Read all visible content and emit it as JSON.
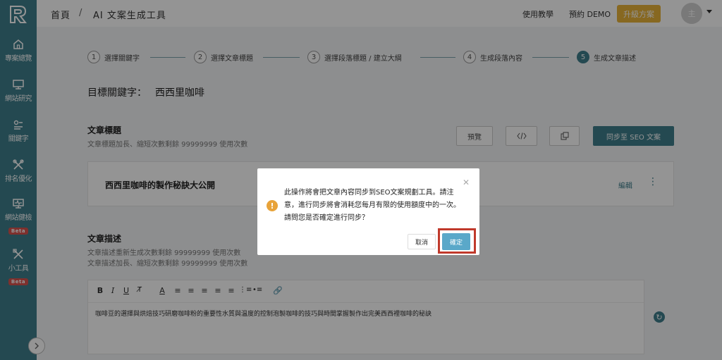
{
  "header": {
    "breadcrumb_home": "首頁",
    "breadcrumb_sep": "/",
    "breadcrumb_current": "AI 文案生成工具",
    "tutorial": "使用教學",
    "demo": "預約 DEMO",
    "upgrade": "升級方案",
    "avatar": "主"
  },
  "sidebar": {
    "items": [
      {
        "label": "專案總覽",
        "icon": "home-icon"
      },
      {
        "label": "網站研究",
        "icon": "monitor-icon"
      },
      {
        "label": "關鍵字",
        "icon": "keyword-icon"
      },
      {
        "label": "排名優化",
        "icon": "tools-icon"
      },
      {
        "label": "網站健檢",
        "icon": "health-check-icon",
        "badge": "Beta"
      },
      {
        "label": "小工具",
        "icon": "widgets-icon",
        "badge": "Beta"
      }
    ]
  },
  "steps": [
    {
      "num": "1",
      "label": "選擇關鍵字"
    },
    {
      "num": "2",
      "label": "選擇文章標題"
    },
    {
      "num": "3",
      "label": "選擇段落標題 / 建立大綱"
    },
    {
      "num": "4",
      "label": "生成段落內容"
    },
    {
      "num": "5",
      "label": "生成文章描述"
    }
  ],
  "target": {
    "label": "目標關鍵字：",
    "keyword": "西西里咖啡"
  },
  "article_title": {
    "heading": "文章標題",
    "sub": "文章標題加長、縮短次數剩餘 99999999 使用次數",
    "preview": "預覽",
    "sync": "同步至 SEO 文案",
    "value": "西西里咖啡的製作秘訣大公開",
    "edit": "編輯"
  },
  "article_desc": {
    "heading": "文章描述",
    "sub1": "文章描述重新生成次數剩餘 99999999 使用次數",
    "sub2": "文章描述加長、縮短次數剩餘 99999999 使用次數",
    "content": "咖啡豆的選擇與烘焙技巧研磨咖啡粉的重要性水質與溫度的控制泡製咖啡的技巧與時間掌握製作出完美西西裡咖啡的秘訣"
  },
  "modal": {
    "message": "此操作將會把文章內容同步到SEO文案規劃工具。請注意，進行同步將會消耗您每月有限的使用額度中的一次。請問您是否確定進行同步？",
    "cancel": "取消",
    "confirm": "確定"
  },
  "colors": {
    "sidebar": "#3f7e8c",
    "upgrade": "#e8b33a",
    "confirm": "#5aa8c9",
    "highlight": "#c0392b"
  }
}
